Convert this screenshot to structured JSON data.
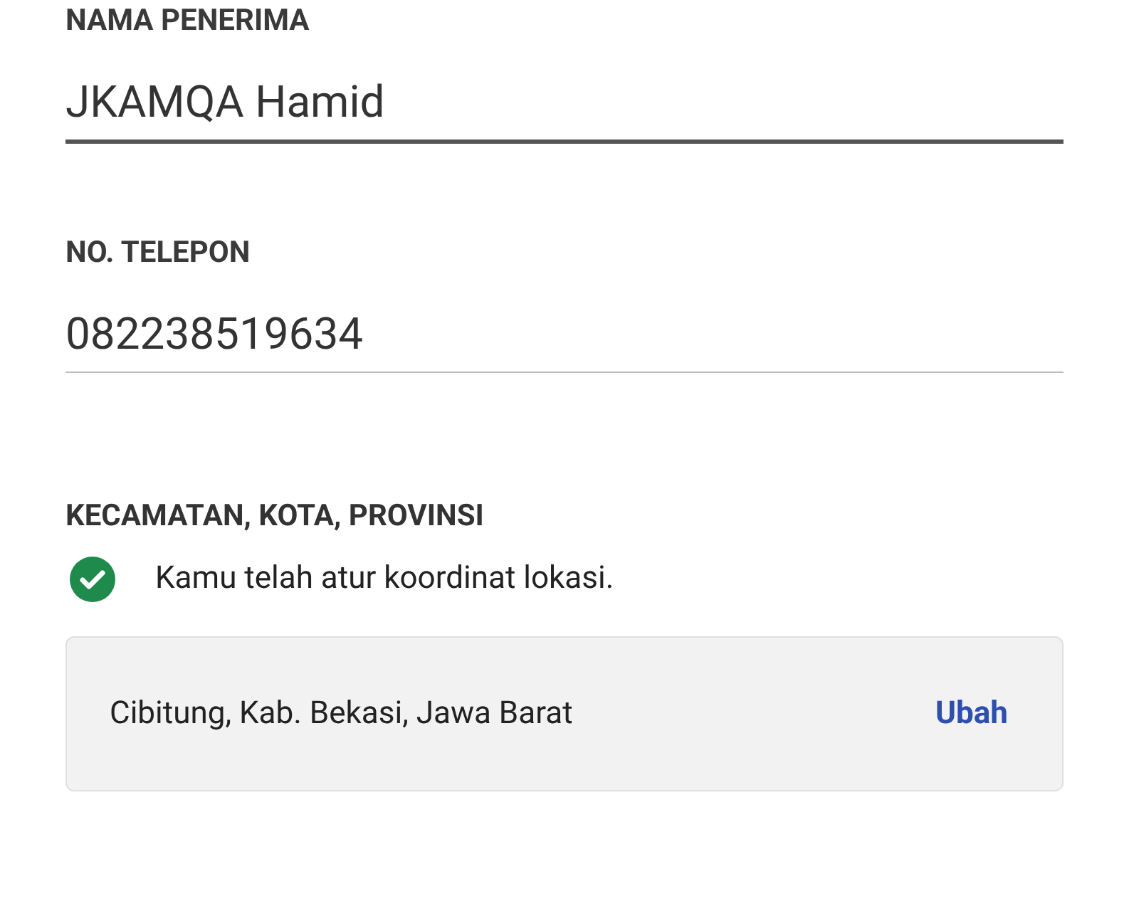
{
  "fields": [
    {
      "label": "NAMA PENERIMA",
      "value": "JKAMQA Hamid",
      "focused": true
    },
    {
      "label": "NO. TELEPON",
      "value": "082238519634",
      "focused": false
    }
  ],
  "location": {
    "label": "KECAMATAN, KOTA, PROVINSI",
    "coordinates_set": true,
    "status": "Kamu telah atur koordinat lokasi.",
    "address": "Cibitung, Kab. Bekasi, Jawa Barat",
    "action": "Ubah"
  }
}
